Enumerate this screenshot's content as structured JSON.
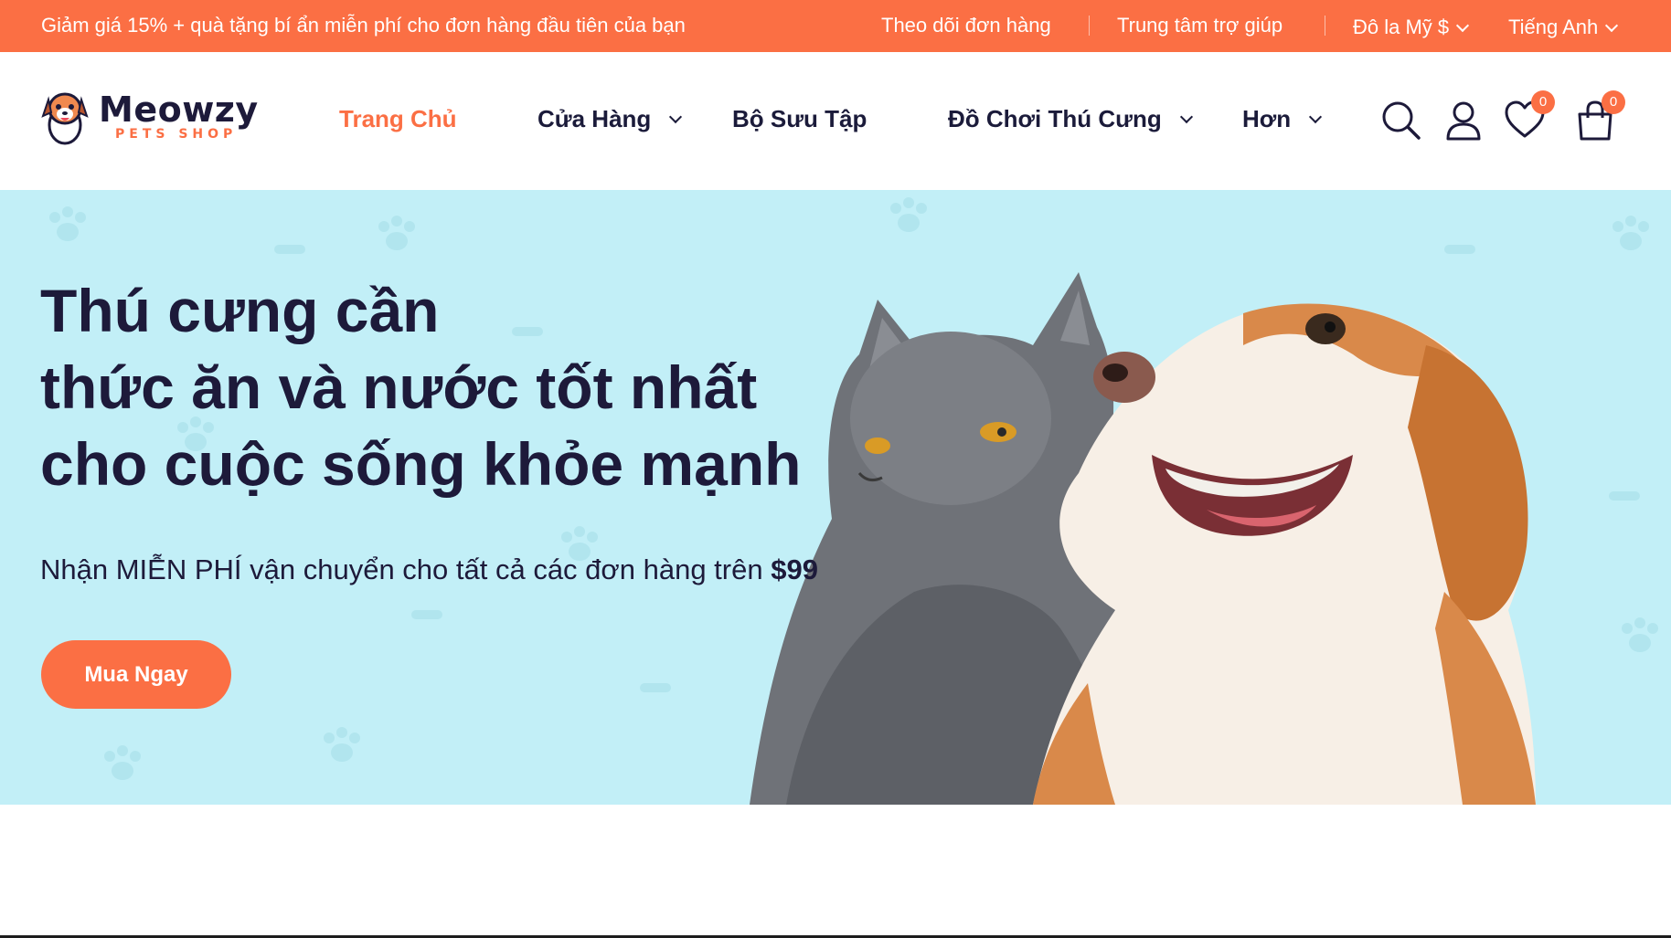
{
  "topbar": {
    "promo": "Giảm giá 15% + quà tặng bí ẩn miễn phí cho đơn hàng đầu tiên của bạn",
    "track_order": "Theo dõi đơn hàng",
    "help_center": "Trung tâm trợ giúp",
    "currency": "Đô la Mỹ $",
    "language": "Tiếng Anh"
  },
  "brand": {
    "name": "Meowzy",
    "tagline": "PETS SHOP"
  },
  "nav": {
    "home": "Trang Chủ",
    "shop": "Cửa Hàng",
    "collections": "Bộ Sưu Tập",
    "pet_toys": "Đồ Chơi Thú Cưng",
    "more": "Hơn"
  },
  "header_icons": {
    "search": "search-icon",
    "account": "user-icon",
    "wishlist": "heart-icon",
    "cart": "bag-icon",
    "wishlist_count": "0",
    "cart_count": "0"
  },
  "hero": {
    "title_line1": "Thú cưng cần",
    "title_line2": "thức ăn và nước tốt nhất",
    "title_line3": "cho cuộc sống khỏe mạnh",
    "subtitle": "Nhận MIỄN PHÍ vận chuyển cho tất cả các đơn hàng trên",
    "subtitle_amount": "$99",
    "cta_label": "Mua Ngay"
  },
  "colors": {
    "accent": "#fb6f44",
    "hero_bg": "#c2eff7",
    "text_dark": "#1d1a3a"
  }
}
